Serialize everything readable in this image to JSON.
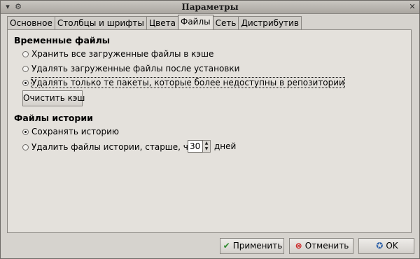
{
  "window": {
    "title": "Параметры",
    "menu_icon": "menu-icon",
    "app_icon": "gear-icon",
    "close_icon": "close-icon"
  },
  "tabs": [
    {
      "label": "Основное",
      "active": false
    },
    {
      "label": "Столбцы и шрифты",
      "active": false
    },
    {
      "label": "Цвета",
      "active": false
    },
    {
      "label": "Файлы",
      "active": true
    },
    {
      "label": "Сеть",
      "active": false
    },
    {
      "label": "Дистрибутив",
      "active": false
    }
  ],
  "temp_files": {
    "title": "Временные файлы",
    "options": [
      {
        "label": "Хранить все загруженные файлы в кэше",
        "checked": false
      },
      {
        "label": "Удалять загруженные файлы после установки",
        "checked": false
      },
      {
        "label": "Удалять только те пакеты, которые более недоступны в репозитории",
        "checked": true
      }
    ],
    "clear_button": "Очистить кэш"
  },
  "history": {
    "title": "Файлы истории",
    "options": [
      {
        "label": "Сохранять историю",
        "checked": true
      },
      {
        "label": "Удалить файлы истории, старше, чем:",
        "checked": false
      }
    ],
    "days_value": "30",
    "days_unit": "дней"
  },
  "buttons": {
    "apply": "Применить",
    "cancel": "Отменить",
    "ok": "OK"
  },
  "colors": {
    "apply_icon": "#2e8b2e",
    "cancel_icon": "#cc2222",
    "ok_icon": "#2a5fa8"
  }
}
